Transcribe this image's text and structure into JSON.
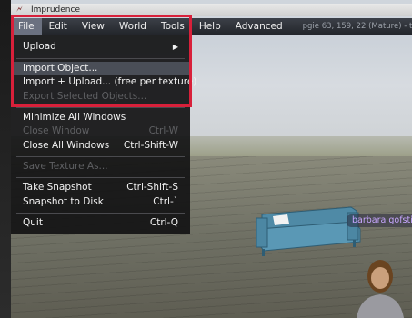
{
  "window": {
    "title": "Imprudence"
  },
  "menubar": {
    "items": [
      {
        "label": "File"
      },
      {
        "label": "Edit"
      },
      {
        "label": "View"
      },
      {
        "label": "World"
      },
      {
        "label": "Tools"
      },
      {
        "label": "Help"
      },
      {
        "label": "Advanced"
      }
    ],
    "status": "pgie 63, 159, 22 (Mature) - testr"
  },
  "file_menu": {
    "upload": "Upload",
    "import_object": "Import Object...",
    "import_upload": "Import + Upload... (free per texture)",
    "export_selected": "Export Selected Objects...",
    "minimize_all": "Minimize All Windows",
    "close_window": "Close Window",
    "close_window_shortcut": "Ctrl-W",
    "close_all": "Close All Windows",
    "close_all_shortcut": "Ctrl-Shift-W",
    "save_texture": "Save Texture As...",
    "take_snapshot": "Take Snapshot",
    "take_snapshot_shortcut": "Ctrl-Shift-S",
    "snapshot_disk": "Snapshot to Disk",
    "snapshot_disk_shortcut": "Ctrl-`",
    "quit": "Quit",
    "quit_shortcut": "Ctrl-Q"
  },
  "scene": {
    "avatar_name": "barbara gofsti"
  },
  "colors": {
    "highlight": "#d8203a",
    "menu_bg": "#23262b",
    "name_tag_text": "#c7a6ff",
    "sofa": "#4f8aa6"
  }
}
